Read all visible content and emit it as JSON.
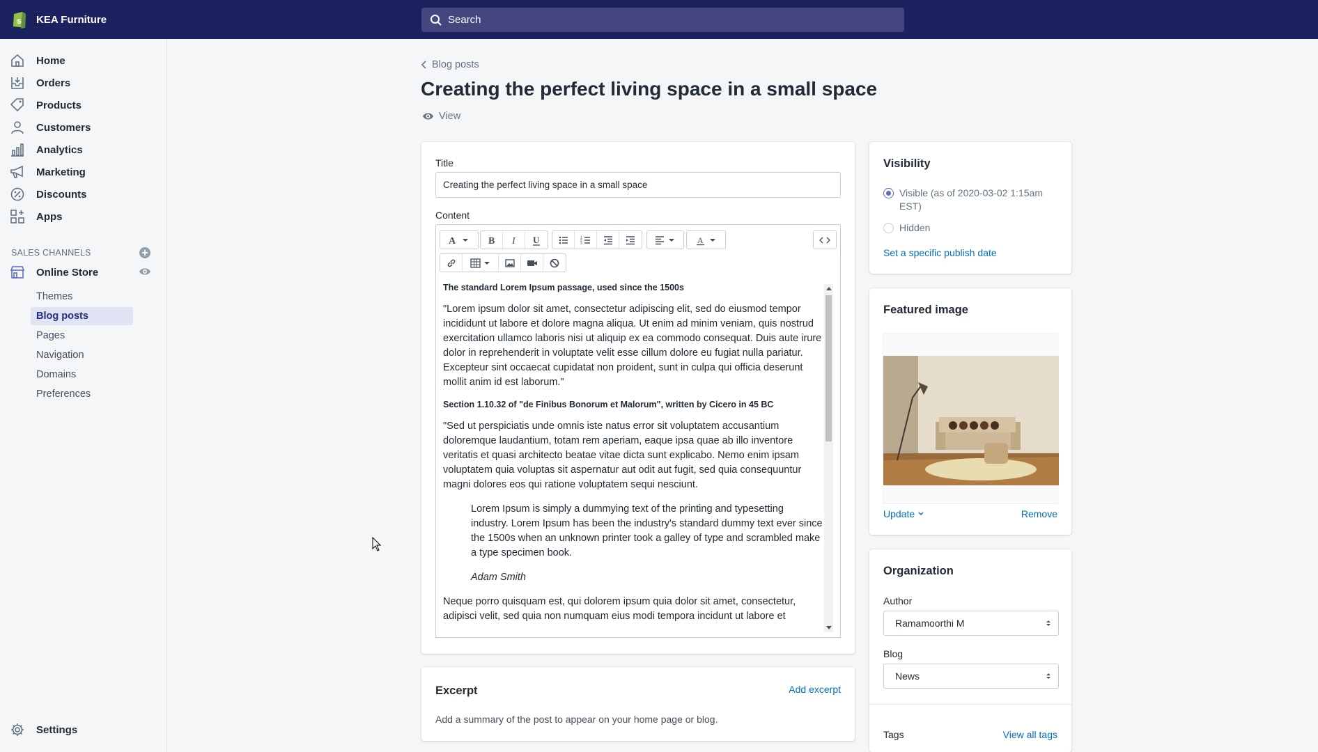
{
  "topbar": {
    "store_name": "KEA Furniture",
    "search_placeholder": "Search"
  },
  "sidebar": {
    "items": [
      {
        "label": "Home",
        "icon": "home-icon"
      },
      {
        "label": "Orders",
        "icon": "orders-icon"
      },
      {
        "label": "Products",
        "icon": "tag-icon"
      },
      {
        "label": "Customers",
        "icon": "person-icon"
      },
      {
        "label": "Analytics",
        "icon": "bar-chart-icon"
      },
      {
        "label": "Marketing",
        "icon": "megaphone-icon"
      },
      {
        "label": "Discounts",
        "icon": "discount-icon"
      },
      {
        "label": "Apps",
        "icon": "apps-icon"
      }
    ],
    "sales_channels_label": "SALES CHANNELS",
    "online_store_label": "Online Store",
    "sub_items": [
      "Themes",
      "Blog posts",
      "Pages",
      "Navigation",
      "Domains",
      "Preferences"
    ],
    "active_sub_item": "Blog posts",
    "settings_label": "Settings"
  },
  "header": {
    "breadcrumb": "Blog posts",
    "title": "Creating the perfect living space in a small space",
    "view_label": "View"
  },
  "post_card": {
    "title_label": "Title",
    "title_value": "Creating the perfect living space in a  small space",
    "content_label": "Content"
  },
  "editor": {
    "heading1": "The standard Lorem Ipsum passage, used since the 1500s",
    "para1": "\"Lorem ipsum dolor sit amet, consectetur adipiscing elit, sed do eiusmod tempor incididunt ut labore et dolore magna aliqua. Ut enim ad minim veniam, quis nostrud exercitation ullamco laboris nisi ut aliquip ex ea commodo consequat. Duis aute irure dolor in reprehenderit in voluptate velit esse cillum dolore eu fugiat nulla pariatur. Excepteur sint occaecat cupidatat non proident, sunt in culpa qui officia deserunt mollit anim id est laborum.\"",
    "heading2": "Section 1.10.32 of \"de Finibus Bonorum et Malorum\", written by Cicero in 45 BC",
    "para2": "\"Sed ut perspiciatis unde omnis iste natus error sit voluptatem accusantium doloremque laudantium, totam rem aperiam, eaque ipsa quae ab illo inventore veritatis et quasi architecto beatae vitae dicta sunt explicabo. Nemo enim ipsam voluptatem quia voluptas sit aspernatur aut odit aut fugit, sed quia consequuntur magni dolores eos qui ratione voluptatem sequi nesciunt.",
    "quote": "Lorem Ipsum is simply a dummying text of the printing and typesetting industry. Lorem Ipsum has been the industry's standard dummy text ever since the 1500s when an unknown printer took a galley of type and scrambled make a type specimen book.",
    "quote_author": "Adam Smith",
    "para3": "Neque porro quisquam est, qui dolorem ipsum quia dolor sit amet, consectetur, adipisci velit, sed quia non numquam eius modi tempora incidunt ut labore et"
  },
  "excerpt": {
    "title": "Excerpt",
    "add_label": "Add excerpt",
    "description": "Add a summary of the post to appear on your home page or blog."
  },
  "visibility": {
    "title": "Visibility",
    "visible_label": "Visible (as of 2020-03-02 1:15am EST)",
    "hidden_label": "Hidden",
    "publish_date_link": "Set a specific publish date",
    "selected": "Visible"
  },
  "featured_image": {
    "title": "Featured image",
    "update_label": "Update",
    "remove_label": "Remove"
  },
  "organization": {
    "title": "Organization",
    "author_label": "Author",
    "author_value": "Ramamoorthi M",
    "blog_label": "Blog",
    "blog_value": "News",
    "tags_label": "Tags",
    "view_all_tags": "View all tags"
  },
  "colors": {
    "topbar": "#1c2260",
    "accent": "#5c6ac4",
    "link": "#006fbb"
  }
}
